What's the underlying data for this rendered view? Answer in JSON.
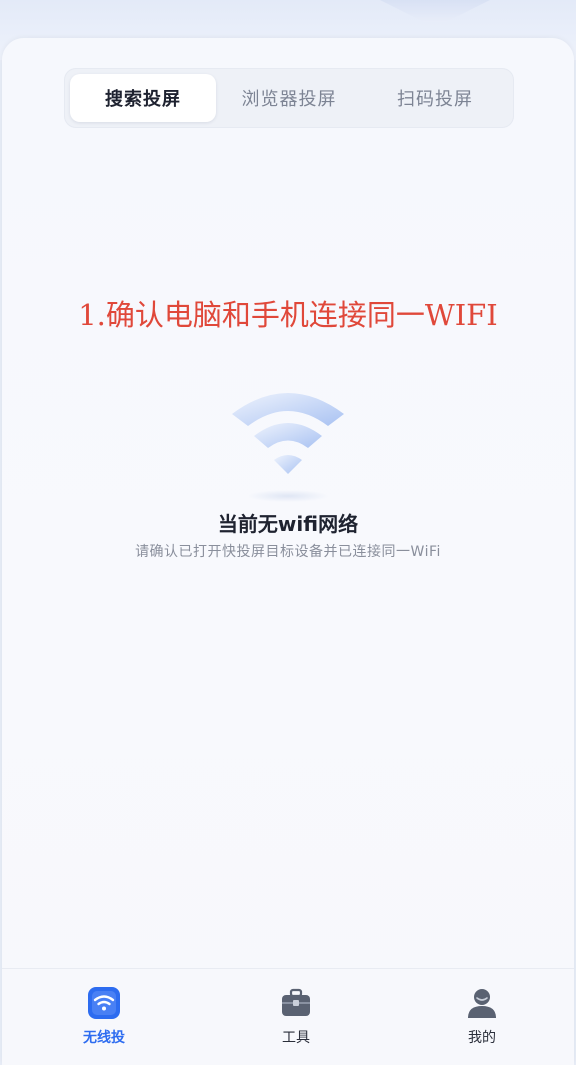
{
  "segmented": {
    "tabs": [
      {
        "label": "搜索投屏",
        "active": true
      },
      {
        "label": "浏览器投屏",
        "active": false
      },
      {
        "label": "扫码投屏",
        "active": false
      }
    ]
  },
  "annotation": "1.确认电脑和手机连接同一WIFI",
  "empty_state": {
    "icon": "wifi-icon",
    "title": "当前无wifi网络",
    "description": "请确认已打开快投屏目标设备并已连接同一WiFi"
  },
  "tabbar": {
    "items": [
      {
        "label": "无线投",
        "icon": "wifi-box-icon",
        "active": true
      },
      {
        "label": "工具",
        "icon": "toolbox-icon",
        "active": false
      },
      {
        "label": "我的",
        "icon": "user-icon",
        "active": false
      }
    ]
  },
  "colors": {
    "accent": "#2d6cf0",
    "annotation": "#e0483a",
    "wifi_icon": "#b9cdf5"
  }
}
